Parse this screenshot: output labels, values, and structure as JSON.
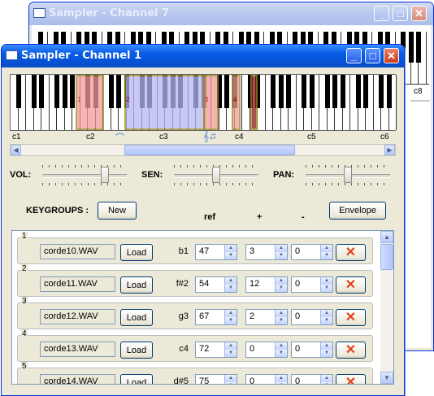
{
  "back_window": {
    "title": "Sampler - Channel 7",
    "key_label": "c8"
  },
  "front_window": {
    "title": "Sampler - Channel 1"
  },
  "keyboard": {
    "octave_labels": [
      "c1",
      "c2",
      "c3",
      "c4",
      "c5",
      "c6"
    ],
    "range_marks": [
      "1",
      "2",
      "3",
      "4",
      "5"
    ],
    "highlight_colors": {
      "red": "#f29a9a",
      "blue": "#b7b7f4",
      "outline": "#9a8a20"
    }
  },
  "controls": {
    "vol_label": "VOL:",
    "sen_label": "SEN:",
    "pan_label": "PAN:",
    "vol_level": 0.77,
    "sen_level": 0.5,
    "pan_level": 0.5
  },
  "keygroups": {
    "label": "KEYGROUPS :",
    "new_button": "New",
    "col_ref": "ref",
    "col_plus": "+",
    "col_minus": "-",
    "envelope_button": "Envelope",
    "load_label": "Load",
    "groups": [
      {
        "num": "1",
        "file": "corde10.WAV",
        "note": "b1",
        "ref": "47",
        "plus": "3",
        "minus": "0"
      },
      {
        "num": "2",
        "file": "corde11.WAV",
        "note": "f#2",
        "ref": "54",
        "plus": "12",
        "minus": "0"
      },
      {
        "num": "3",
        "file": "corde12.WAV",
        "note": "g3",
        "ref": "67",
        "plus": "2",
        "minus": "0"
      },
      {
        "num": "4",
        "file": "corde13.WAV",
        "note": "c4",
        "ref": "72",
        "plus": "0",
        "minus": "0"
      },
      {
        "num": "5",
        "file": "corde14.WAV",
        "note": "d#5",
        "ref": "75",
        "plus": "0",
        "minus": "0"
      }
    ]
  }
}
